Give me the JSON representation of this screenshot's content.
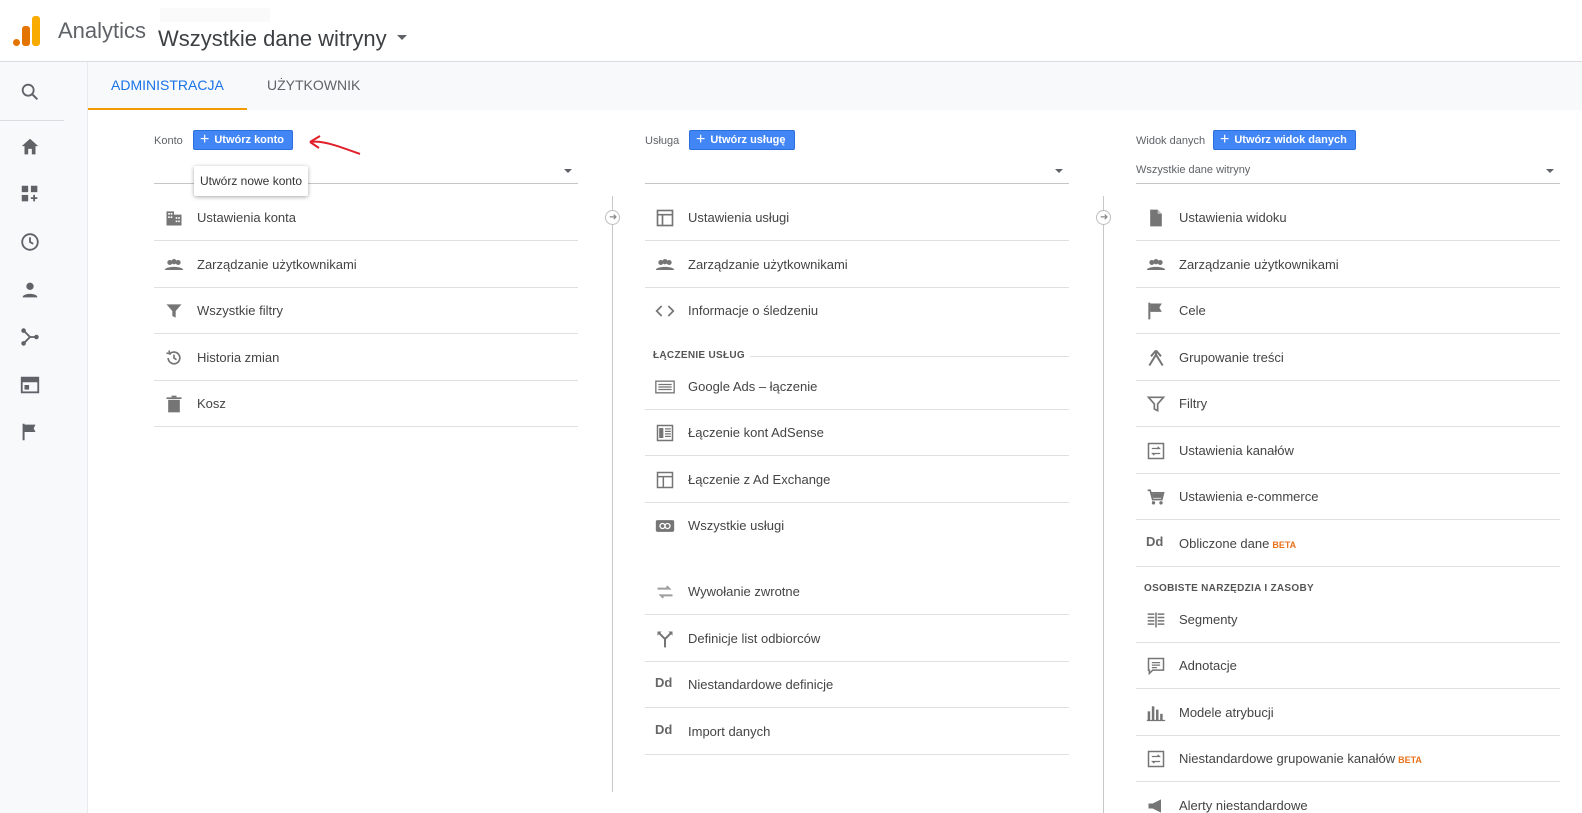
{
  "header": {
    "app_title": "Analytics",
    "property_title": "Wszystkie dane witryny"
  },
  "tabs": [
    {
      "label": "ADMINISTRACJA",
      "active": true
    },
    {
      "label": "UŻYTKOWNIK",
      "active": false
    }
  ],
  "account": {
    "label": "Konto",
    "create_button": "Utwórz konto",
    "tooltip": "Utwórz nowe konto",
    "selected": "",
    "items": [
      {
        "label": "Ustawienia konta",
        "icon": "building-icon"
      },
      {
        "label": "Zarządzanie użytkownikami",
        "icon": "people-icon"
      },
      {
        "label": "Wszystkie filtry",
        "icon": "filter-icon"
      },
      {
        "label": "Historia zmian",
        "icon": "history-icon"
      },
      {
        "label": "Kosz",
        "icon": "trash-icon"
      }
    ]
  },
  "property": {
    "label": "Usługa",
    "create_button": "Utwórz usługę",
    "selected": "",
    "items": [
      {
        "label": "Ustawienia usługi",
        "icon": "window-icon"
      },
      {
        "label": "Zarządzanie użytkownikami",
        "icon": "people-icon"
      },
      {
        "label": "Informacje o śledzeniu",
        "icon": "code-icon"
      }
    ],
    "section_linking": "ŁĄCZENIE USŁUG",
    "linking_items": [
      {
        "label": "Google Ads – łączenie",
        "icon": "ads-icon"
      },
      {
        "label": "Łączenie kont AdSense",
        "icon": "adsense-icon"
      },
      {
        "label": "Łączenie z Ad Exchange",
        "icon": "adexchange-icon"
      },
      {
        "label": "Wszystkie usługi",
        "icon": "link-icon"
      }
    ],
    "other_items": [
      {
        "label": "Wywołanie zwrotne",
        "icon": "postback-icon"
      },
      {
        "label": "Definicje list odbiorców",
        "icon": "fork-icon"
      },
      {
        "label": "Niestandardowe definicje",
        "icon": "dd-icon"
      },
      {
        "label": "Import danych",
        "icon": "dd-icon"
      }
    ]
  },
  "view": {
    "label": "Widok danych",
    "create_button": "Utwórz widok danych",
    "selected": "Wszystkie dane witryny",
    "items": [
      {
        "label": "Ustawienia widoku",
        "icon": "document-icon"
      },
      {
        "label": "Zarządzanie użytkownikami",
        "icon": "people-icon"
      },
      {
        "label": "Cele",
        "icon": "flag-icon"
      },
      {
        "label": "Grupowanie treści",
        "icon": "merge-icon"
      },
      {
        "label": "Filtry",
        "icon": "filter-icon"
      },
      {
        "label": "Ustawienia kanałów",
        "icon": "channel-icon"
      },
      {
        "label": "Ustawienia e-commerce",
        "icon": "cart-icon"
      },
      {
        "label": "Obliczone dane",
        "icon": "dd-icon",
        "badge": "BETA"
      }
    ],
    "section_personal": "OSOBISTE NARZĘDZIA I ZASOBY",
    "personal_items": [
      {
        "label": "Segmenty",
        "icon": "segments-icon"
      },
      {
        "label": "Adnotacje",
        "icon": "comment-icon"
      },
      {
        "label": "Modele atrybucji",
        "icon": "bars-icon"
      },
      {
        "label": "Niestandardowe grupowanie kanałów",
        "icon": "channel-icon",
        "badge": "BETA"
      },
      {
        "label": "Alerty niestandardowe",
        "icon": "megaphone-icon"
      }
    ]
  },
  "colors": {
    "accent": "#1a73e8",
    "button": "#4285f4",
    "tab_underline": "#f29900",
    "beta": "#e8711a",
    "annotation_arrow": "#e0202a"
  }
}
